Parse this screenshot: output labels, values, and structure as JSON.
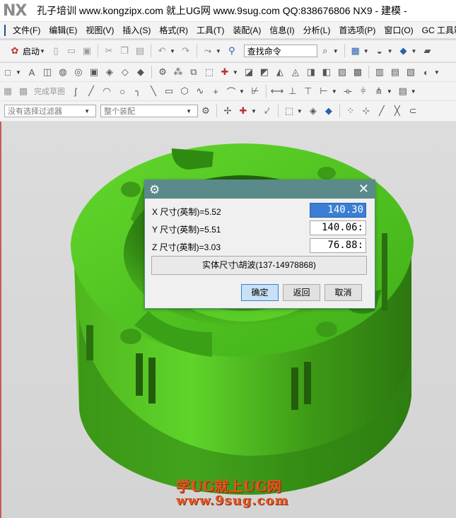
{
  "app": {
    "logo": "NX",
    "title": "孔子培训 www.kongzipx.com 就上UG网 www.9sug.com QQ:838676806 NX9 - 建模 -"
  },
  "menu": {
    "items": [
      "文件(F)",
      "编辑(E)",
      "视图(V)",
      "插入(S)",
      "格式(R)",
      "工具(T)",
      "装配(A)",
      "信息(I)",
      "分析(L)",
      "首选项(P)",
      "窗口(O)",
      "GC 工具箱"
    ]
  },
  "toolbar": {
    "start_label": "启动",
    "search_value": "查找命令",
    "finish_sketch": "完成草图"
  },
  "filters": {
    "selection_filter": "没有选择过滤器",
    "assembly_scope": "整个装配"
  },
  "dialog": {
    "x_label": "X 尺寸(英制)=5.52",
    "x_value": "140.30",
    "y_label": "Y 尺寸(英制)=5.51",
    "y_value": "140.06:",
    "z_label": "Z 尺寸(英制)=3.03",
    "z_value": "76.88:",
    "info_button": "实体尺寸\\胡波(137-14978868)",
    "ok": "确定",
    "back": "返回",
    "cancel": "取消"
  },
  "watermark": {
    "line1": "学UG就上UG网",
    "line2": "www.9sug.com"
  },
  "colors": {
    "part_green": "#4ec21a",
    "dialog_header": "#5a8b8a",
    "selection_blue": "#3a7fd4"
  }
}
